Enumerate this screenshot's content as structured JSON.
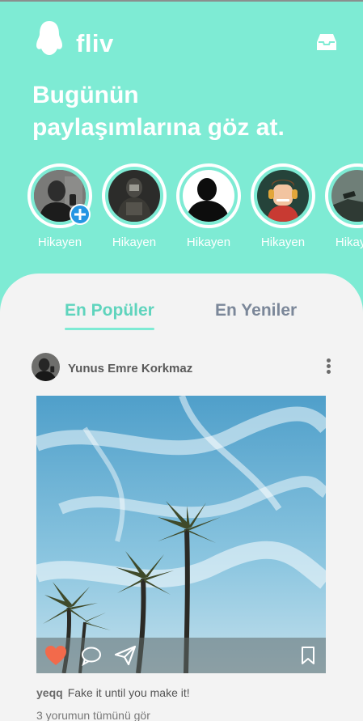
{
  "app": {
    "title": "fliv",
    "logo_icon": "penguin-icon",
    "inbox_icon": "inbox-icon"
  },
  "headline": {
    "line1": "Bugünün",
    "line2": "paylaşımlarına göz at."
  },
  "stories": [
    {
      "label": "Hikayen",
      "avatar": "user-avatar-mirror-selfie",
      "has_add": true
    },
    {
      "label": "Hikayen",
      "avatar": "soldier-avatar"
    },
    {
      "label": "Hikayen",
      "avatar": "silhouette-avatar"
    },
    {
      "label": "Hikayen",
      "avatar": "cartoon-headphones-avatar"
    },
    {
      "label": "Hikayen",
      "avatar": "dark-figure-avatar"
    }
  ],
  "tabs": {
    "popular": "En Popüler",
    "new": "En Yeniler",
    "active": "popular"
  },
  "post": {
    "author": "Yunus Emre Korkmaz",
    "image": "palm-trees-blue-sky",
    "liked": true,
    "caption_user": "yeqq",
    "caption_text": "Fake it until you make it!",
    "comments_link": "3 yorumun tümünü gör"
  },
  "colors": {
    "accent": "#7eebd4",
    "tab_active": "#5fd4bd",
    "tab_inactive": "#7b8799",
    "heart": "#f26a4b",
    "badge": "#2596e3"
  }
}
